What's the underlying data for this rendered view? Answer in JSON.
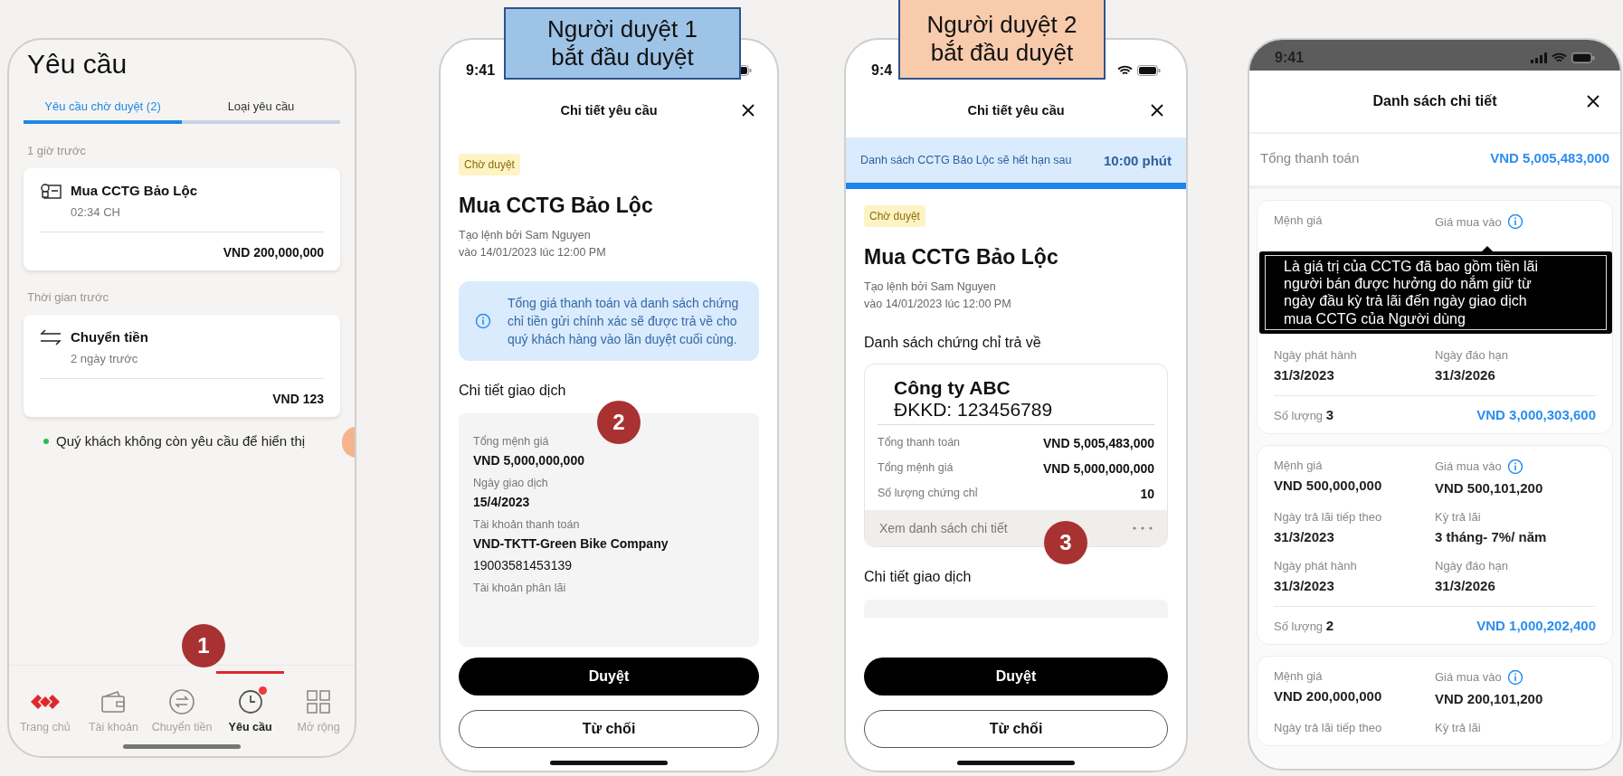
{
  "callouts": [
    {
      "lines": [
        "Người duyệt 1",
        "bắt đầu duyệt"
      ],
      "color": "#9dc3e6"
    },
    {
      "lines": [
        "Người duyệt 2",
        "bắt đầu duyệt"
      ],
      "color": "#f8cbad"
    }
  ],
  "step_markers": [
    "1",
    "2",
    "3"
  ],
  "request_list": {
    "title": "Yêu cầu",
    "tabs": [
      {
        "label": "Yêu cầu chờ duyệt (2)",
        "selected": true
      },
      {
        "label": "Loại yêu cầu",
        "selected": false
      }
    ],
    "groups": [
      {
        "heading": "1 giờ trước",
        "items": [
          {
            "kind": "certificate",
            "title": "Mua CCTG Bảo Lộc",
            "time": "02:34 CH",
            "amount": "VND 200,000,000"
          }
        ]
      },
      {
        "heading": "Thời gian trước",
        "items": [
          {
            "kind": "transfer",
            "title": "Chuyển tiền",
            "time": "2 ngày trước",
            "amount": "VND 123"
          }
        ]
      }
    ],
    "empty_note": "Quý khách không còn yêu cầu để hiển thị",
    "nav": [
      {
        "kind": "home",
        "label": "Trang chủ",
        "selected": false,
        "badge": false
      },
      {
        "kind": "wallet",
        "label": "Tài khoản",
        "selected": false,
        "badge": false
      },
      {
        "kind": "transfer",
        "label": "Chuyển tiền",
        "selected": false,
        "badge": false
      },
      {
        "kind": "clock",
        "label": "Yêu cầu",
        "selected": true,
        "badge": true
      },
      {
        "kind": "grid",
        "label": "Mở rộng",
        "selected": false,
        "badge": false
      }
    ]
  },
  "approval_1": {
    "time": "9:41",
    "header": "Chi tiết yêu cầu",
    "status": "Chờ duyệt",
    "title": "Mua CCTG Bảo Lộc",
    "created_by": "Tạo lệnh bởi Sam Nguyen",
    "created_at": "vào 14/01/2023 lúc 12:00 PM",
    "info_note": "Tổng giá thanh toán và danh sách chứng chỉ tiền gửi chính xác sẽ được trả về cho quý khách hàng vào lần duyệt cuối cùng.",
    "section": "Chi tiết giao dịch",
    "fields": [
      {
        "label": "Tổng mệnh giá",
        "values": [
          "VND 5,000,000,000"
        ]
      },
      {
        "label": "Ngày giao dịch",
        "values": [
          "15/4/2023"
        ]
      },
      {
        "label": "Tài khoản thanh toán",
        "values": [
          "VND-TKTT-Green Bike Company",
          "19003581453139"
        ]
      },
      {
        "label": "Tài khoản phân lãi"
      }
    ],
    "buttons": [
      {
        "kind": "primary",
        "label": "Duyệt"
      },
      {
        "kind": "secondary",
        "label": "Từ chối"
      }
    ]
  },
  "approval_2": {
    "time": "9:4",
    "header": "Chi tiết yêu cầu",
    "expiry": {
      "text": "Danh sách CCTG Bảo Lộc sẽ hết hạn sau",
      "countdown": "10:00 phút",
      "level": 1
    },
    "status": "Chờ duyệt",
    "title": "Mua CCTG Bảo Lộc",
    "created_by": "Tạo lệnh bởi Sam Nguyen",
    "created_at": "vào 14/01/2023 lúc 12:00 PM",
    "certificates_heading": "Danh sách chứng chỉ trả về",
    "certificate": {
      "company": "Công ty ABC",
      "registration": "ĐKKD: 123456789",
      "rows": [
        {
          "label": "Tổng thanh toán",
          "value": "VND 5,005,483,000"
        },
        {
          "label": "Tổng mệnh giá",
          "value": "VND 5,000,000,000"
        },
        {
          "label": "Số lượng chứng chỉ",
          "value": "10"
        }
      ],
      "link": "Xem danh sách chi tiết"
    },
    "section": "Chi tiết giao dịch",
    "buttons": [
      {
        "kind": "primary",
        "label": "Duyệt"
      },
      {
        "kind": "secondary",
        "label": "Từ chối"
      }
    ]
  },
  "detail_list": {
    "time": "9:41",
    "title": "Danh sách chi tiết",
    "total_label": "Tổng thanh toán",
    "total": "VND 5,005,483,000",
    "cards": [
      {
        "cells": [
          {
            "label": "Mệnh giá",
            "info": false
          },
          {
            "label": "Giá mua vào",
            "info": true
          },
          {
            "label": "Ngày phát hành",
            "value": "31/3/2023",
            "info": false
          },
          {
            "label": "Ngày đáo hạn",
            "value": "31/3/2026",
            "info": false
          }
        ],
        "tooltip": "Là giá trị của CCTG đã bao gồm tiền lãi người bán được hưởng do nắm giữ từ ngày đầu kỳ trả lãi đến ngày giao dịch mua CCTG của Người dùng",
        "quantity_label": "Số lượng",
        "quantity": "3",
        "amount": "VND 3,000,303,600"
      },
      {
        "cells": [
          {
            "label": "Mệnh giá",
            "value": "VND 500,000,000",
            "info": false
          },
          {
            "label": "Giá mua vào",
            "value": "VND 500,101,200",
            "info": true
          },
          {
            "label": "Ngày trả lãi tiếp theo",
            "value": "31/3/2023",
            "info": false
          },
          {
            "label": "Kỳ trả lãi",
            "value": "3 tháng- 7%/ năm",
            "info": false
          },
          {
            "label": "Ngày phát hành",
            "value": "31/3/2023",
            "info": false
          },
          {
            "label": "Ngày đáo hạn",
            "value": "31/3/2026",
            "info": false
          }
        ],
        "quantity_label": "Số lượng",
        "quantity": "2",
        "amount": "VND 1,000,202,400"
      },
      {
        "cells": [
          {
            "label": "Mệnh giá",
            "value": "VND 200,000,000",
            "info": false
          },
          {
            "label": "Giá mua vào",
            "value": "VND 200,101,200",
            "info": true
          },
          {
            "label": "Ngày trả lãi tiếp theo",
            "info": false
          },
          {
            "label": "Kỳ trả lãi",
            "info": false
          }
        ]
      }
    ]
  }
}
